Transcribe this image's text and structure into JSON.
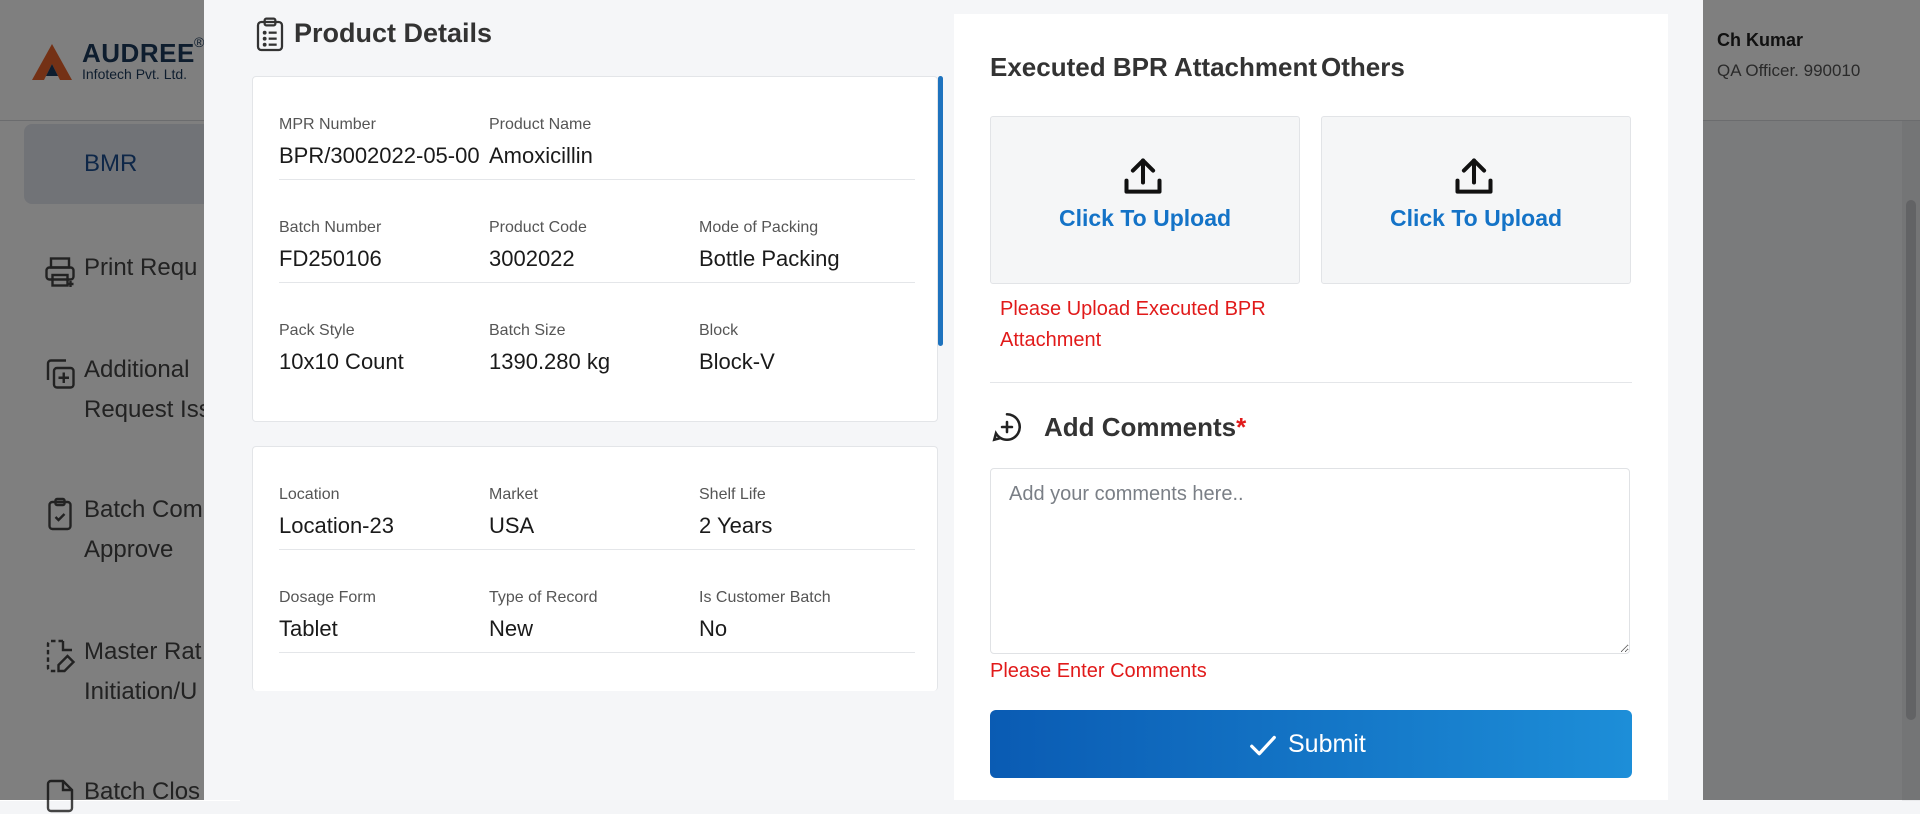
{
  "app": {
    "logo": {
      "name": "AUDREE",
      "registered": "®",
      "subtitle": "Infotech Pvt. Ltd."
    },
    "user": {
      "name": "Ch Kumar",
      "role": "QA Officer. 990010"
    },
    "sidebar": {
      "active": "BMR",
      "items": [
        {
          "label": "Print Requ",
          "icon": "printer-plus-icon"
        },
        {
          "label": "Additional",
          "label2": "Request Iss",
          "icon": "copy-plus-icon"
        },
        {
          "label": "Batch Com",
          "label2": "Approve",
          "icon": "clipboard-check-icon"
        },
        {
          "label": "Master Rat",
          "label2": "Initiation/U",
          "icon": "file-edit-icon"
        },
        {
          "label": "Batch Clos",
          "icon": "file-icon"
        }
      ]
    }
  },
  "modal": {
    "product_details": {
      "title": "Product Details",
      "icon": "clipboard-list-icon",
      "card1": [
        [
          {
            "label": "MPR Number",
            "value": "BPR/3002022-05-00"
          },
          {
            "label": "Product Name",
            "value": "Amoxicillin"
          }
        ],
        [
          {
            "label": "Batch Number",
            "value": "FD250106"
          },
          {
            "label": "Product Code",
            "value": "3002022"
          },
          {
            "label": "Mode of Packing",
            "value": "Bottle Packing"
          }
        ],
        [
          {
            "label": "Pack Style",
            "value": "10x10 Count"
          },
          {
            "label": "Batch Size",
            "value": "1390.280 kg"
          },
          {
            "label": "Block",
            "value": "Block-V"
          }
        ]
      ],
      "card2": [
        [
          {
            "label": "Location",
            "value": "Location-23"
          },
          {
            "label": "Market",
            "value": "USA"
          },
          {
            "label": "Shelf Life",
            "value": "2 Years"
          }
        ],
        [
          {
            "label": "Dosage Form",
            "value": "Tablet"
          },
          {
            "label": "Type of Record",
            "value": "New"
          },
          {
            "label": "Is Customer Batch",
            "value": "No"
          }
        ]
      ]
    },
    "attachments": {
      "executed_title": "Executed BPR Attachment",
      "others_title": "Others",
      "upload_label": "Click To Upload",
      "upload_icon": "upload-icon",
      "executed_error": [
        "Please Upload Executed BPR",
        "Attachment"
      ]
    },
    "comments": {
      "title": "Add Comments",
      "required_mark": "*",
      "icon": "message-plus-icon",
      "placeholder": "Add your comments here..",
      "value": "",
      "error": "Please Enter Comments"
    },
    "submit": {
      "label": "Submit",
      "icon": "check-icon"
    }
  },
  "colors": {
    "accent": "#1473c7",
    "error": "#e11a1a",
    "submit_gradient_start": "#0a5bb3",
    "submit_gradient_end": "#1d8ed8",
    "overlay": "#000000"
  }
}
